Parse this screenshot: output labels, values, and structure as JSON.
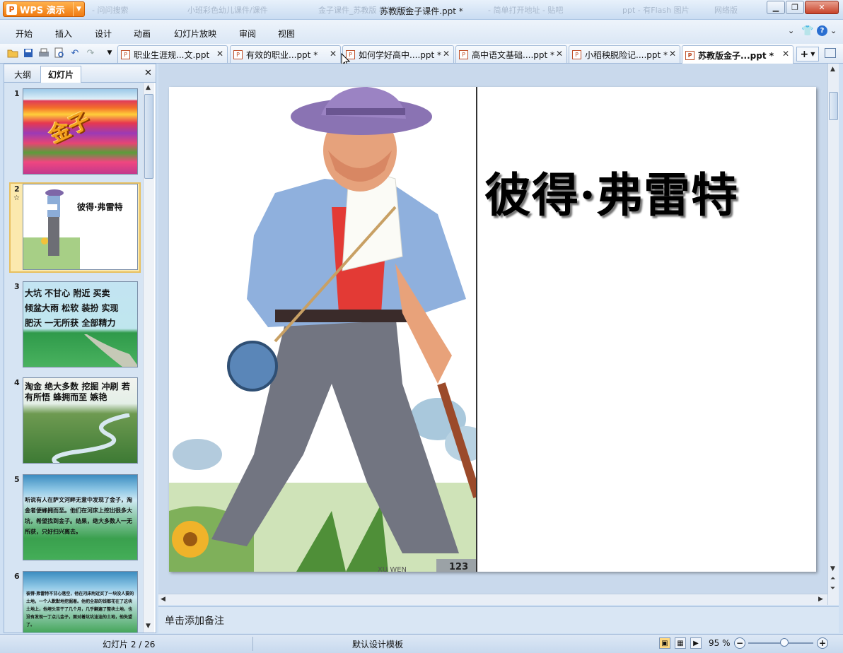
{
  "app": {
    "button_label": "WPS 演示",
    "logo_letter": "P"
  },
  "window": {
    "title": "苏教版金子课件.ppt *"
  },
  "ghost_tabs": [
    "- 问问搜索",
    "小班彩色幼儿课件/课件",
    "金子课件_苏教版 教学课件",
    "- 简单打开地址 - 贴吧",
    "ppt - 有Flash 图片",
    "网络版"
  ],
  "menu": [
    "开始",
    "插入",
    "设计",
    "动画",
    "幻灯片放映",
    "审阅",
    "视图"
  ],
  "doc_tabs": [
    {
      "label": "职业生涯规...文.ppt",
      "active": false
    },
    {
      "label": "有效的职业...ppt *",
      "active": false
    },
    {
      "label": "如何学好高中....ppt *",
      "active": false
    },
    {
      "label": "高中语文基础....ppt *",
      "active": false
    },
    {
      "label": "小稻秧脱险记....ppt *",
      "active": false
    },
    {
      "label": "苏教版金子...ppt *",
      "active": true
    }
  ],
  "panel": {
    "tab_outline": "大纲",
    "tab_slides": "幻灯片"
  },
  "thumbnails": [
    {
      "num": "1",
      "title": "金子"
    },
    {
      "num": "2",
      "title": "彼得·弗雷特"
    },
    {
      "num": "3",
      "lines": [
        "大坑 不甘心 附近 买卖",
        "倾盆大雨 松软 装扮 实现",
        "肥沃  一无所获  全部精力"
      ]
    },
    {
      "num": "4",
      "lines": [
        "淘金 绝大多数 挖掘 冲刷 若",
        "有所悟 蜂拥而至 嫉艳"
      ]
    },
    {
      "num": "5",
      "text": "听说有人在萨文河畔无意中发现了金子，淘金者便蜂拥而至。他们在河床上挖出很多大坑，希望找到金子。结果，绝大多数人一无所获，只好扫兴离去。"
    },
    {
      "num": "6",
      "text": "彼得·弗雷特不甘心落空，他在河床附近买了一块没人要的土地，一个人默默地挖掘着。他把全部的钱都花在了这块土地上，他埋头苦干了几个月，几乎翻遍了整块土地，也没有发现一丁点儿金子，面对着坑坑洼洼的土地，他失望了。"
    }
  ],
  "slide": {
    "title": "彼得·弗雷特",
    "page_mark": "123",
    "artist_mark": "XU WEN"
  },
  "notes": {
    "placeholder": "单击添加备注"
  },
  "status": {
    "slide_counter": "幻灯片 2 / 26",
    "template": "默认设计模板",
    "zoom": "95 %",
    "zoom_fraction": 0.55
  }
}
